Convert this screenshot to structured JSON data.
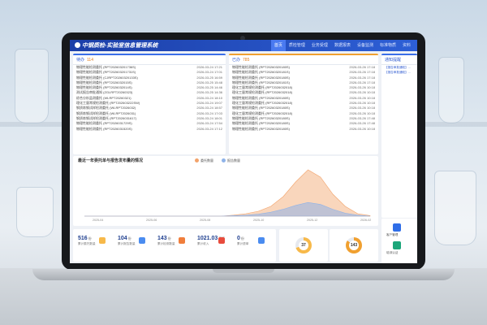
{
  "app": {
    "title": "中钢质检-实验室信息管理系统",
    "nav": [
      "首页",
      "质检管理",
      "业务受理",
      "数据报表",
      "设备监测",
      "标准物质",
      "资料"
    ]
  },
  "todo": {
    "title": "待办",
    "count": "114",
    "rows": [
      {
        "name": "物理性能检测委托 (RPT202603201736S)",
        "time": "2026-03-24 17:21"
      },
      {
        "name": "物理性能检测委托 (RPT202603201731S)",
        "time": "2026-03-24 17:01"
      },
      {
        "name": "物理性能检测委托 (CJRPT20260320133S)",
        "time": "2026-03-25 16:59"
      },
      {
        "name": "物理性能检测委托 (RPT2026032015S)",
        "time": "2026-03-25 15:48"
      },
      {
        "name": "物理性能检测委托 (RPT2026032014S)",
        "time": "2026-03-25 14:46"
      },
      {
        "name": "测试报告审批通知 (ZGLRPT20260323)",
        "time": "2026-03-25 14:36"
      },
      {
        "name": "综合分析监测委托 (WLRPT20260321)",
        "time": "2026-03-24 18:10"
      },
      {
        "name": "理化工量常规检测委托 (RPT202603222SW)",
        "time": "2026-03-24 19:07"
      },
      {
        "name": "钢质炼钢试样检测委托 (WLRPT2026032)",
        "time": "2026-03-24 18:57"
      },
      {
        "name": "钢质炼钢试样检测委托 (WLRPT2026031)",
        "time": "2026-03-24 17:03"
      },
      {
        "name": "钢质炼钢试样检测委托 (RPT2026031617)",
        "time": "2026-03-24 18:01"
      },
      {
        "name": "物理性能检测委托 (RPT2026031729S)",
        "time": "2026-03-24 17:54"
      },
      {
        "name": "物理性能检测委托 (RPT2026031520S)",
        "time": "2026-03-24 17:12"
      }
    ]
  },
  "done": {
    "title": "已办",
    "count": "785",
    "rows": [
      {
        "name": "物理性能检测委托 (RPT20260320180S)",
        "time": "2026-03-26 17:18"
      },
      {
        "name": "物理性能检测委托 (RPT20260320181S)",
        "time": "2026-03-26 17:18"
      },
      {
        "name": "物理性能检测委托 (RPT20260320180S)",
        "time": "2026-03-26 17:18"
      },
      {
        "name": "物理性能检测委托 (RPT20260320181S)",
        "time": "2026-03-26 17:18"
      },
      {
        "name": "理化工量常规检测委托 (RPT2026032018)",
        "time": "2026-03-26 10:18"
      },
      {
        "name": "理化工量常规检测委托 (RPT2026032018)",
        "time": "2026-03-26 10:18"
      },
      {
        "name": "物理性能检测委托 (RPT20260320180S)",
        "time": "2026-03-26 10:18"
      },
      {
        "name": "理化工量常规检测委托 (RPT2026032018)",
        "time": "2026-03-26 10:18"
      },
      {
        "name": "物理性能检测委托 (RPT20260320180S)",
        "time": "2026-03-26 10:18"
      },
      {
        "name": "理化工量常规检测委托 (RPT2026032018)",
        "time": "2026-03-26 10:18"
      },
      {
        "name": "物理性能检测委托 (RPT20260320180S)",
        "time": "2026-03-26 17:48"
      },
      {
        "name": "物理性能检测委托 (RPT20260320180S)",
        "time": "2026-03-26 17:48"
      },
      {
        "name": "物理性能检测委托 (RPT20260320180S)",
        "time": "2026-03-26 10:18"
      }
    ]
  },
  "notice": {
    "title": "通知提醒",
    "items": [
      "【报告审批通知】...",
      "【报告审批通知】..."
    ],
    "app_label": "客户管理",
    "app_label2": "培训认证"
  },
  "chart_data": {
    "type": "area",
    "title": "最近一年委托单与报告发布量的情况",
    "series": [
      {
        "name": "委托数量",
        "color": "#f2a36b",
        "values": [
          0,
          0,
          0,
          0,
          0,
          0,
          0,
          0,
          0,
          0,
          0,
          0,
          2,
          5,
          10,
          20,
          40,
          70,
          95,
          80,
          45,
          20,
          5,
          1
        ]
      },
      {
        "name": "报告数量",
        "color": "#8fb3e8",
        "values": [
          0,
          0,
          0,
          0,
          0,
          0,
          0,
          0,
          0,
          0,
          0,
          0,
          1,
          2,
          4,
          8,
          14,
          22,
          28,
          24,
          14,
          6,
          2,
          0
        ]
      }
    ],
    "x_ticks": [
      "2025-04",
      "2025-06",
      "2025-08",
      "2025-10",
      "2025-12",
      "2026-02"
    ]
  },
  "stats": [
    {
      "value": "516",
      "unit": "份",
      "label": "累计委托数量",
      "color": "#f7b94a"
    },
    {
      "value": "104",
      "unit": "份",
      "label": "累计报告数量",
      "color": "#4a8cf0"
    },
    {
      "value": "143",
      "unit": "份",
      "label": "累计检测数量",
      "color": "#f07e3c"
    },
    {
      "value": "1021.03",
      "unit": "万元",
      "label": "累计收入",
      "color": "#e84c3d"
    },
    {
      "value": "0",
      "unit": "份",
      "label": "累计退单",
      "color": "#4a8cf0"
    }
  ],
  "rings": [
    {
      "value": "37",
      "fraction": 0.7,
      "color": "#f7b94a"
    },
    {
      "value": "143",
      "fraction": 0.85,
      "color": "#f0a030"
    }
  ]
}
